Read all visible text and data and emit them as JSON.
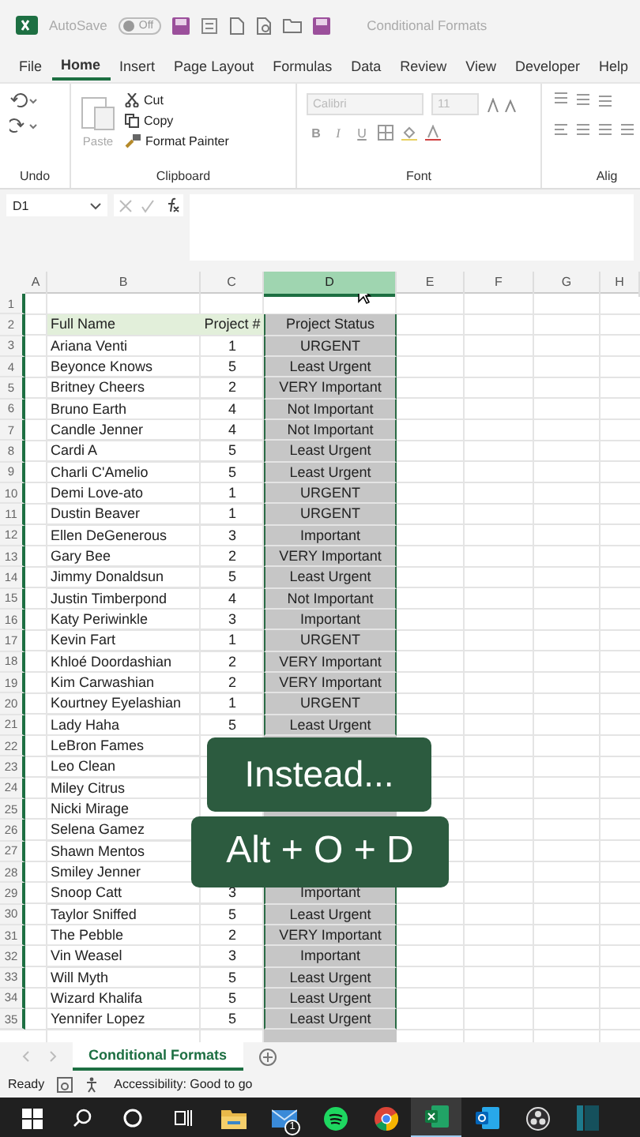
{
  "title_bar": {
    "autosave_label": "AutoSave",
    "autosave_toggle": {
      "label": "Off",
      "on": false
    },
    "document_title": "Conditional Formats"
  },
  "ribbon_tabs": [
    {
      "label": "File",
      "selected": false
    },
    {
      "label": "Home",
      "selected": true
    },
    {
      "label": "Insert",
      "selected": false
    },
    {
      "label": "Page Layout",
      "selected": false
    },
    {
      "label": "Formulas",
      "selected": false
    },
    {
      "label": "Data",
      "selected": false
    },
    {
      "label": "Review",
      "selected": false
    },
    {
      "label": "View",
      "selected": false
    },
    {
      "label": "Developer",
      "selected": false
    },
    {
      "label": "Help",
      "selected": false
    }
  ],
  "ribbon": {
    "undo_label": "Undo",
    "clipboard": {
      "paste": "Paste",
      "cut": "Cut",
      "copy": "Copy",
      "format_painter": "Format Painter",
      "label": "Clipboard"
    },
    "font": {
      "font_name": "Calibri",
      "font_size": "11",
      "bold": "B",
      "italic": "I",
      "underline": "U",
      "label": "Font"
    },
    "alignment_label": "Alig"
  },
  "name_box": "D1",
  "column_headers": [
    {
      "label": "A",
      "selected": false
    },
    {
      "label": "B",
      "selected": false
    },
    {
      "label": "C",
      "selected": false
    },
    {
      "label": "D",
      "selected": true
    },
    {
      "label": "E",
      "selected": false
    },
    {
      "label": "F",
      "selected": false
    },
    {
      "label": "G",
      "selected": false
    },
    {
      "label": "H",
      "selected": false
    }
  ],
  "rows": [
    {
      "number": "1"
    },
    {
      "number": "2",
      "kind": "header",
      "b": "Full Name",
      "c": "Project #",
      "d": "Project Status"
    },
    {
      "number": "3",
      "kind": "data",
      "b": "Ariana Venti",
      "c": "1",
      "d": "URGENT"
    },
    {
      "number": "4",
      "kind": "data",
      "b": "Beyonce Knows",
      "c": "5",
      "d": "Least Urgent"
    },
    {
      "number": "5",
      "kind": "data",
      "b": "Britney Cheers",
      "c": "2",
      "d": "VERY Important"
    },
    {
      "number": "6",
      "kind": "data",
      "b": "Bruno Earth",
      "c": "4",
      "d": "Not Important"
    },
    {
      "number": "7",
      "kind": "data",
      "b": "Candle Jenner",
      "c": "4",
      "d": "Not Important"
    },
    {
      "number": "8",
      "kind": "data",
      "b": "Cardi A",
      "c": "5",
      "d": "Least Urgent"
    },
    {
      "number": "9",
      "kind": "data",
      "b": "Charli C'Amelio",
      "c": "5",
      "d": "Least Urgent"
    },
    {
      "number": "10",
      "kind": "data",
      "b": "Demi Love-ato",
      "c": "1",
      "d": "URGENT"
    },
    {
      "number": "11",
      "kind": "data",
      "b": "Dustin Beaver",
      "c": "1",
      "d": "URGENT"
    },
    {
      "number": "12",
      "kind": "data",
      "b": "Ellen DeGenerous",
      "c": "3",
      "d": "Important"
    },
    {
      "number": "13",
      "kind": "data",
      "b": "Gary Bee",
      "c": "2",
      "d": "VERY Important"
    },
    {
      "number": "14",
      "kind": "data",
      "b": "Jimmy Donaldsun",
      "c": "5",
      "d": "Least Urgent"
    },
    {
      "number": "15",
      "kind": "data",
      "b": "Justin Timberpond",
      "c": "4",
      "d": "Not Important"
    },
    {
      "number": "16",
      "kind": "data",
      "b": "Katy Periwinkle",
      "c": "3",
      "d": "Important"
    },
    {
      "number": "17",
      "kind": "data",
      "b": "Kevin Fart",
      "c": "1",
      "d": "URGENT"
    },
    {
      "number": "18",
      "kind": "data",
      "b": "Khloé Doordashian",
      "c": "2",
      "d": "VERY Important"
    },
    {
      "number": "19",
      "kind": "data",
      "b": "Kim Carwashian",
      "c": "2",
      "d": "VERY Important"
    },
    {
      "number": "20",
      "kind": "data",
      "b": "Kourtney Eyelashian",
      "c": "1",
      "d": "URGENT"
    },
    {
      "number": "21",
      "kind": "data",
      "b": "Lady Haha",
      "c": "5",
      "d": "Least Urgent"
    },
    {
      "number": "22",
      "kind": "data",
      "b": "LeBron Fames"
    },
    {
      "number": "23",
      "kind": "data",
      "b": "Leo Clean"
    },
    {
      "number": "24",
      "kind": "data",
      "b": "Miley Citrus"
    },
    {
      "number": "25",
      "kind": "data",
      "b": "Nicki Mirage"
    },
    {
      "number": "26",
      "kind": "data",
      "b": "Selena Gamez"
    },
    {
      "number": "27",
      "kind": "data",
      "b": "Shawn Mentos"
    },
    {
      "number": "28",
      "kind": "data",
      "b": "Smiley Jenner"
    },
    {
      "number": "29",
      "kind": "data",
      "b": "Snoop Catt",
      "c": "3",
      "d": "Important"
    },
    {
      "number": "30",
      "kind": "data",
      "b": "Taylor Sniffed",
      "c": "5",
      "d": "Least Urgent"
    },
    {
      "number": "31",
      "kind": "data",
      "b": "The Pebble",
      "c": "2",
      "d": "VERY Important"
    },
    {
      "number": "32",
      "kind": "data",
      "b": "Vin Weasel",
      "c": "3",
      "d": "Important"
    },
    {
      "number": "33",
      "kind": "data",
      "b": "Will Myth",
      "c": "5",
      "d": "Least Urgent"
    },
    {
      "number": "34",
      "kind": "data",
      "b": "Wizard Khalifa",
      "c": "5",
      "d": "Least Urgent"
    },
    {
      "number": "35",
      "kind": "data",
      "b": "Yennifer Lopez",
      "c": "5",
      "d": "Least Urgent"
    }
  ],
  "overlay_captions": [
    "Instead...",
    "Alt + O + D"
  ],
  "sheet_tabs": [
    {
      "label": "Conditional Formats",
      "selected": true
    }
  ],
  "status_bar": {
    "status": "Ready",
    "accessibility": "Accessibility: Good to go"
  },
  "taskbar": {
    "apps": [
      {
        "kind": "start",
        "active": false
      },
      {
        "kind": "search",
        "active": false
      },
      {
        "kind": "cortana",
        "active": false
      },
      {
        "kind": "taskview",
        "active": false
      },
      {
        "kind": "explorer",
        "active": false
      },
      {
        "kind": "mail",
        "active": false,
        "badge": "1"
      },
      {
        "kind": "spotify",
        "active": false
      },
      {
        "kind": "chrome",
        "active": false
      },
      {
        "kind": "excel",
        "active": true
      },
      {
        "kind": "outlook",
        "active": false
      },
      {
        "kind": "obs",
        "active": false
      },
      {
        "kind": "panel",
        "active": false
      }
    ]
  }
}
